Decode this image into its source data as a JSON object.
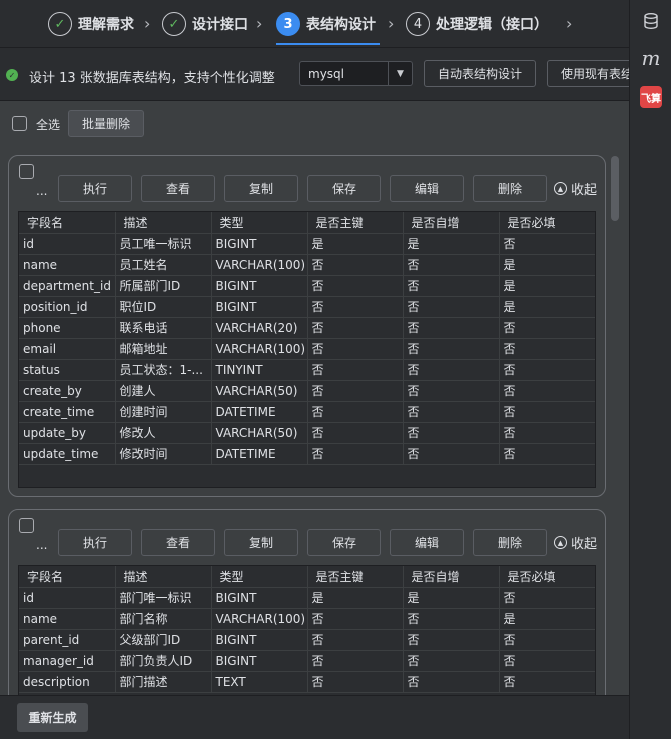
{
  "stepper": {
    "steps": [
      {
        "index": "✓",
        "label": "理解需求",
        "state": "done"
      },
      {
        "index": "✓",
        "label": "设计接口",
        "state": "done"
      },
      {
        "index": "3",
        "label": "表结构设计",
        "state": "active"
      },
      {
        "index": "4",
        "label": "处理逻辑（接口）",
        "state": "pending"
      }
    ],
    "chevron": "›"
  },
  "infobar": {
    "status_icon": "check-circle-icon",
    "message": "设计 13 张数据库表结构，支持个性化调整",
    "db_type": "mysql",
    "auto_design_label": "自动表结构设计",
    "use_existing_label": "使用现有表结构"
  },
  "toolbar": {
    "select_all_label": "全选",
    "batch_delete_label": "批量删除"
  },
  "card_actions": {
    "execute": "执行",
    "view": "查看",
    "copy": "复制",
    "save": "保存",
    "edit": "编辑",
    "delete": "删除",
    "collapse": "收起",
    "ellipsis": "..."
  },
  "columns": [
    "字段名",
    "描述",
    "类型",
    "是否主键",
    "是否自增",
    "是否必填"
  ],
  "tables": [
    {
      "rows": [
        [
          "id",
          "员工唯一标识",
          "BIGINT",
          "是",
          "是",
          "否"
        ],
        [
          "name",
          "员工姓名",
          "VARCHAR(100)",
          "否",
          "否",
          "是"
        ],
        [
          "department_id",
          "所属部门ID",
          "BIGINT",
          "否",
          "否",
          "是"
        ],
        [
          "position_id",
          "职位ID",
          "BIGINT",
          "否",
          "否",
          "是"
        ],
        [
          "phone",
          "联系电话",
          "VARCHAR(20)",
          "否",
          "否",
          "否"
        ],
        [
          "email",
          "邮箱地址",
          "VARCHAR(100)",
          "否",
          "否",
          "否"
        ],
        [
          "status",
          "员工状态：1-...",
          "TINYINT",
          "否",
          "否",
          "否"
        ],
        [
          "create_by",
          "创建人",
          "VARCHAR(50)",
          "否",
          "否",
          "否"
        ],
        [
          "create_time",
          "创建时间",
          "DATETIME",
          "否",
          "否",
          "否"
        ],
        [
          "update_by",
          "修改人",
          "VARCHAR(50)",
          "否",
          "否",
          "否"
        ],
        [
          "update_time",
          "修改时间",
          "DATETIME",
          "否",
          "否",
          "否"
        ]
      ]
    },
    {
      "rows": [
        [
          "id",
          "部门唯一标识",
          "BIGINT",
          "是",
          "是",
          "否"
        ],
        [
          "name",
          "部门名称",
          "VARCHAR(100)",
          "否",
          "否",
          "是"
        ],
        [
          "parent_id",
          "父级部门ID",
          "BIGINT",
          "否",
          "否",
          "否"
        ],
        [
          "manager_id",
          "部门负责人ID",
          "BIGINT",
          "否",
          "否",
          "否"
        ],
        [
          "description",
          "部门描述",
          "TEXT",
          "否",
          "否",
          "否"
        ]
      ]
    }
  ],
  "footer": {
    "regenerate_label": "重新生成"
  },
  "rail": {
    "db_icon": "database-icon",
    "m_label": "m",
    "fly_label": "飞算"
  }
}
